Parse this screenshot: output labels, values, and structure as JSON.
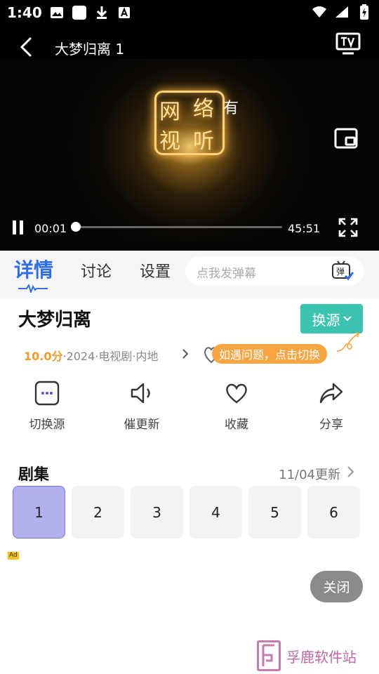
{
  "status": {
    "time": "1:40",
    "icons": [
      "image-icon",
      "app-icon",
      "download-icon",
      "font-icon"
    ],
    "right_icons": [
      "wifi-icon",
      "signal-icon",
      "battery-icon"
    ]
  },
  "header": {
    "title": "大梦归离 1"
  },
  "player": {
    "logo_chars": [
      "网",
      "络",
      "视",
      "听"
    ],
    "logo_extra": "有",
    "current_time": "00:01",
    "total_time": "45:51",
    "progress": 0.01
  },
  "tabs": [
    {
      "label": "详情",
      "active": true
    },
    {
      "label": "讨论",
      "active": false
    },
    {
      "label": "设置",
      "active": false
    }
  ],
  "danmaku": {
    "placeholder": "点我发弹幕",
    "icon_char": "弹"
  },
  "detail": {
    "title": "大梦归离",
    "switch_source": "换源",
    "score": "10.0分",
    "meta": "·2024·电视剧·内地",
    "tip": "如遇问题，点击切换"
  },
  "actions": [
    {
      "label": "切换源",
      "icon": "more-box-icon"
    },
    {
      "label": "催更新",
      "icon": "speaker-icon"
    },
    {
      "label": "收藏",
      "icon": "heart-icon"
    },
    {
      "label": "分享",
      "icon": "share-icon"
    }
  ],
  "episodes": {
    "title": "剧集",
    "update": "11/04更新",
    "items": [
      "1",
      "2",
      "3",
      "4",
      "5",
      "6"
    ],
    "selected": "1"
  },
  "ad": {
    "tag": "Ad",
    "close": "关闭"
  },
  "watermark": {
    "text": "孚鹿软件站"
  },
  "colors": {
    "accent_blue": "#2f6ee8",
    "source_teal": "#3cc3b0",
    "score_orange": "#f29a2e",
    "tip_orange": "#f7a442",
    "episode_selected": "#b3b0ee"
  }
}
